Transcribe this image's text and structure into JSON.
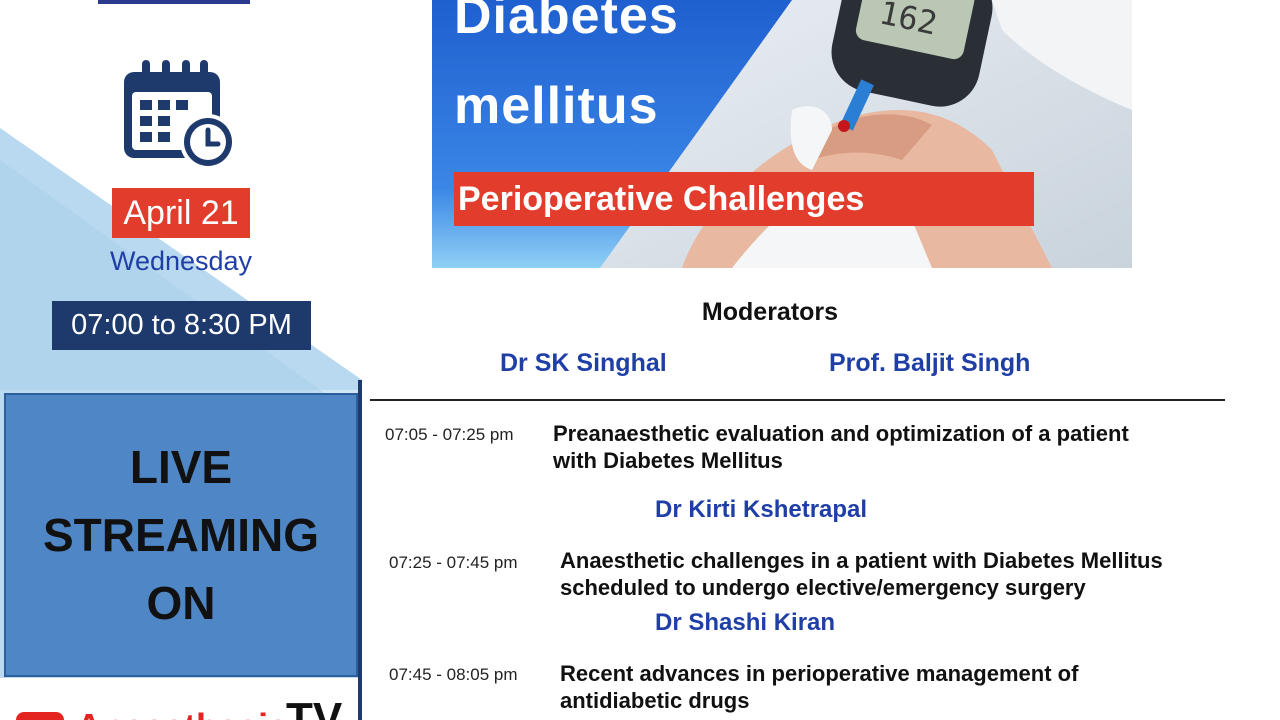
{
  "event": {
    "date": "April 21",
    "weekday": "Wednesday",
    "time": "07:00 to 8:30 PM"
  },
  "live": {
    "lines": [
      "LIVE",
      "STREAMING",
      "ON"
    ]
  },
  "channel": {
    "name": "Anaesthesia",
    "suffix": "TV",
    "brand_color": "#e32420"
  },
  "banner": {
    "title_line1": "Diabetes",
    "title_line2": "mellitus",
    "subtitle": "Perioperative Challenges"
  },
  "moderators": {
    "heading": "Moderators",
    "names": [
      "Dr SK Singhal",
      "Prof. Baljit Singh"
    ]
  },
  "sessions": [
    {
      "time": "07:05 - 07:25 pm",
      "title_lines": [
        "Preanaesthetic evaluation and optimization of a patient",
        "with Diabetes Mellitus"
      ],
      "speaker": "Dr Kirti Kshetrapal"
    },
    {
      "time": "07:25 - 07:45 pm",
      "title_lines": [
        "Anaesthetic challenges in a patient with Diabetes Mellitus",
        "scheduled to undergo elective/emergency surgery"
      ],
      "speaker": "Dr Shashi Kiran"
    },
    {
      "time": "07:45 - 08:05 pm",
      "title_lines": [
        "Recent advances in perioperative management of",
        "antidiabetic drugs"
      ],
      "speaker": ""
    }
  ],
  "colors": {
    "accent_red": "#e23c2d",
    "navy": "#1e3a6d",
    "name_blue": "#1f3fa6",
    "live_blue": "#4f86c6",
    "banner_blue": "#2f6fd6"
  }
}
